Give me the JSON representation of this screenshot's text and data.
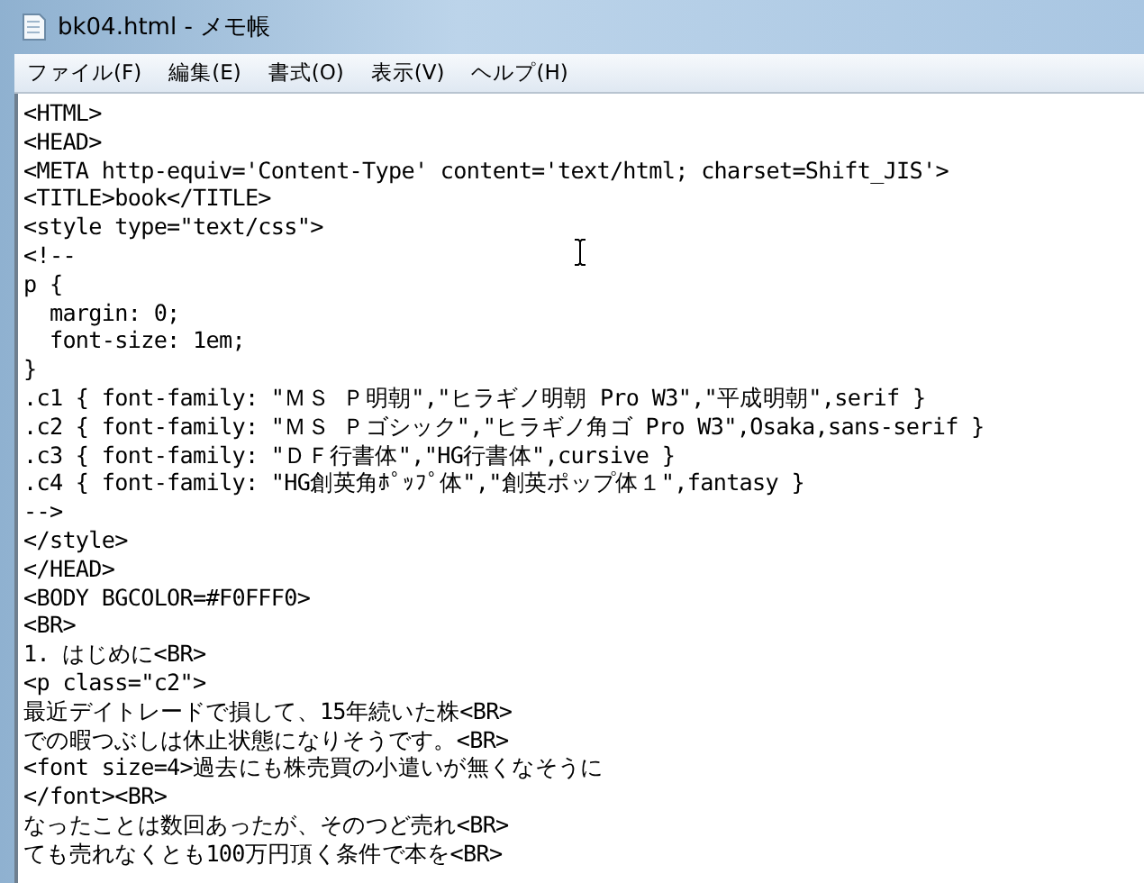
{
  "window": {
    "title": "bk04.html - メモ帳"
  },
  "menu": [
    {
      "label": "ファイル(F)"
    },
    {
      "label": "編集(E)"
    },
    {
      "label": "書式(O)"
    },
    {
      "label": "表示(V)"
    },
    {
      "label": "ヘルプ(H)"
    }
  ],
  "editor": {
    "lines": [
      "<HTML>",
      "<HEAD>",
      "<META http-equiv='Content-Type' content='text/html; charset=Shift_JIS'>",
      "<TITLE>book</TITLE>",
      "<style type=\"text/css\">",
      "<!--",
      "p {",
      "  margin: 0;",
      "  font-size: 1em;",
      "}",
      ".c1 { font-family: \"ＭＳ Ｐ明朝\",\"ヒラギノ明朝 Pro W3\",\"平成明朝\",serif }",
      ".c2 { font-family: \"ＭＳ Ｐゴシック\",\"ヒラギノ角ゴ Pro W3\",Osaka,sans-serif }",
      ".c3 { font-family: \"ＤＦ行書体\",\"HG行書体\",cursive }",
      ".c4 { font-family: \"HG創英角ﾎﾟｯﾌﾟ体\",\"創英ポップ体１\",fantasy }",
      "-->",
      "</style>",
      "</HEAD>",
      "<BODY BGCOLOR=#F0FFF0>",
      "<BR>",
      "1. はじめに<BR>",
      "<p class=\"c2\">",
      "最近デイトレードで損して、15年続いた株<BR>",
      "での暇つぶしは休止状態になりそうです。<BR>",
      "<font size=4>過去にも株売買の小遣いが無くなそうに",
      "</font><BR>",
      "なったことは数回あったが、そのつど売れ<BR>",
      "ても売れなくとも100万円頂く条件で本を<BR>"
    ]
  }
}
